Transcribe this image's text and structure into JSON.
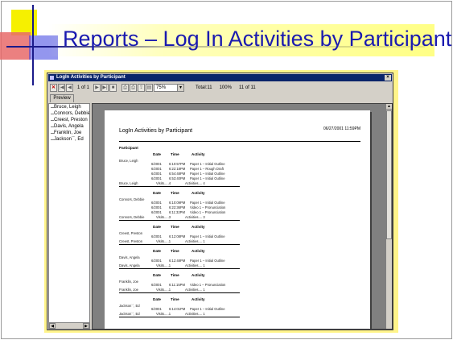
{
  "slide": {
    "title": "Reports – Log In Activities by Participant"
  },
  "window": {
    "title": "LogIn Activities by Participant",
    "close_glyph": "×"
  },
  "toolbar": {
    "page_label": "1 of 1",
    "zoom_value": "75%",
    "total_label": "Total:11",
    "percent_label": "100%",
    "count_label": "11 of 11"
  },
  "tabs": [
    {
      "label": "Preview"
    }
  ],
  "tree": {
    "items": [
      "Bruce, Leigh",
      "Connors, Debbie",
      "Creest, Preston",
      "Davis, Angela",
      "Franklin, Joe",
      "Jackson``, Ed"
    ]
  },
  "report": {
    "title": "LogIn Activities by Participant",
    "date": "06/27/2001 11:59PM",
    "participant_header": "Participant",
    "col_date": "Date",
    "col_time": "Time",
    "col_activity": "Activity",
    "groups": [
      {
        "name": "Bruce, Leigh",
        "rows": [
          [
            "6/2001",
            "6:10:57PM",
            "Paper 1 – Initial Outline"
          ],
          [
            "6/2001",
            "6:22:18PM",
            "Paper 1 – Rough Draft"
          ],
          [
            "6/2001",
            "6:54:48PM",
            "Paper 1 – Initial Outline"
          ],
          [
            "6/2001",
            "6:53:40PM",
            "Paper 1 – Initial Outline"
          ]
        ],
        "footer": [
          "Bruce, Leigh",
          "Visits.....4",
          "Activities.... 4"
        ]
      },
      {
        "name": "Connors, Debbie",
        "rows": [
          [
            "6/2001",
            "6:10:09PM",
            "Paper 1 – Initial Outline"
          ],
          [
            "6/2001",
            "6:22:36PM",
            "Video 1 – Pronunciation"
          ],
          [
            "6/2001",
            "6:11:32PM",
            "Video 1 – Pronunciation"
          ]
        ],
        "footer": [
          "Connors, Debbie",
          "Visits.....3",
          "Activities.... 3"
        ]
      },
      {
        "name": "Creest, Preston",
        "rows": [
          [
            "6/2001",
            "6:12:08PM",
            "Paper 1 – Initial Outline"
          ]
        ],
        "footer": [
          "Creest, Preston",
          "Visits.....1",
          "Activities.... 1"
        ]
      },
      {
        "name": "Davis, Angela",
        "rows": [
          [
            "6/2001",
            "6:12:48PM",
            "Paper 1 – Initial Outline"
          ]
        ],
        "footer": [
          "Davis, Angela",
          "Visits.....1",
          "Activities.... 1"
        ]
      },
      {
        "name": "Franklin, Joe",
        "rows": [
          [
            "6/2001",
            "6:11:15PM",
            "Video 1 – Pronunciation"
          ]
        ],
        "footer": [
          "Franklin, Joe",
          "Visits.....1",
          "Activities.... 1"
        ]
      },
      {
        "name": "Jackson``, Ed",
        "rows": [
          [
            "6/2001",
            "6:14:01PM",
            "Paper 1 – Initial Outline"
          ]
        ],
        "footer": [
          "Jackson``, Ed",
          "Visits.....1",
          "Activities.... 1"
        ]
      }
    ]
  }
}
